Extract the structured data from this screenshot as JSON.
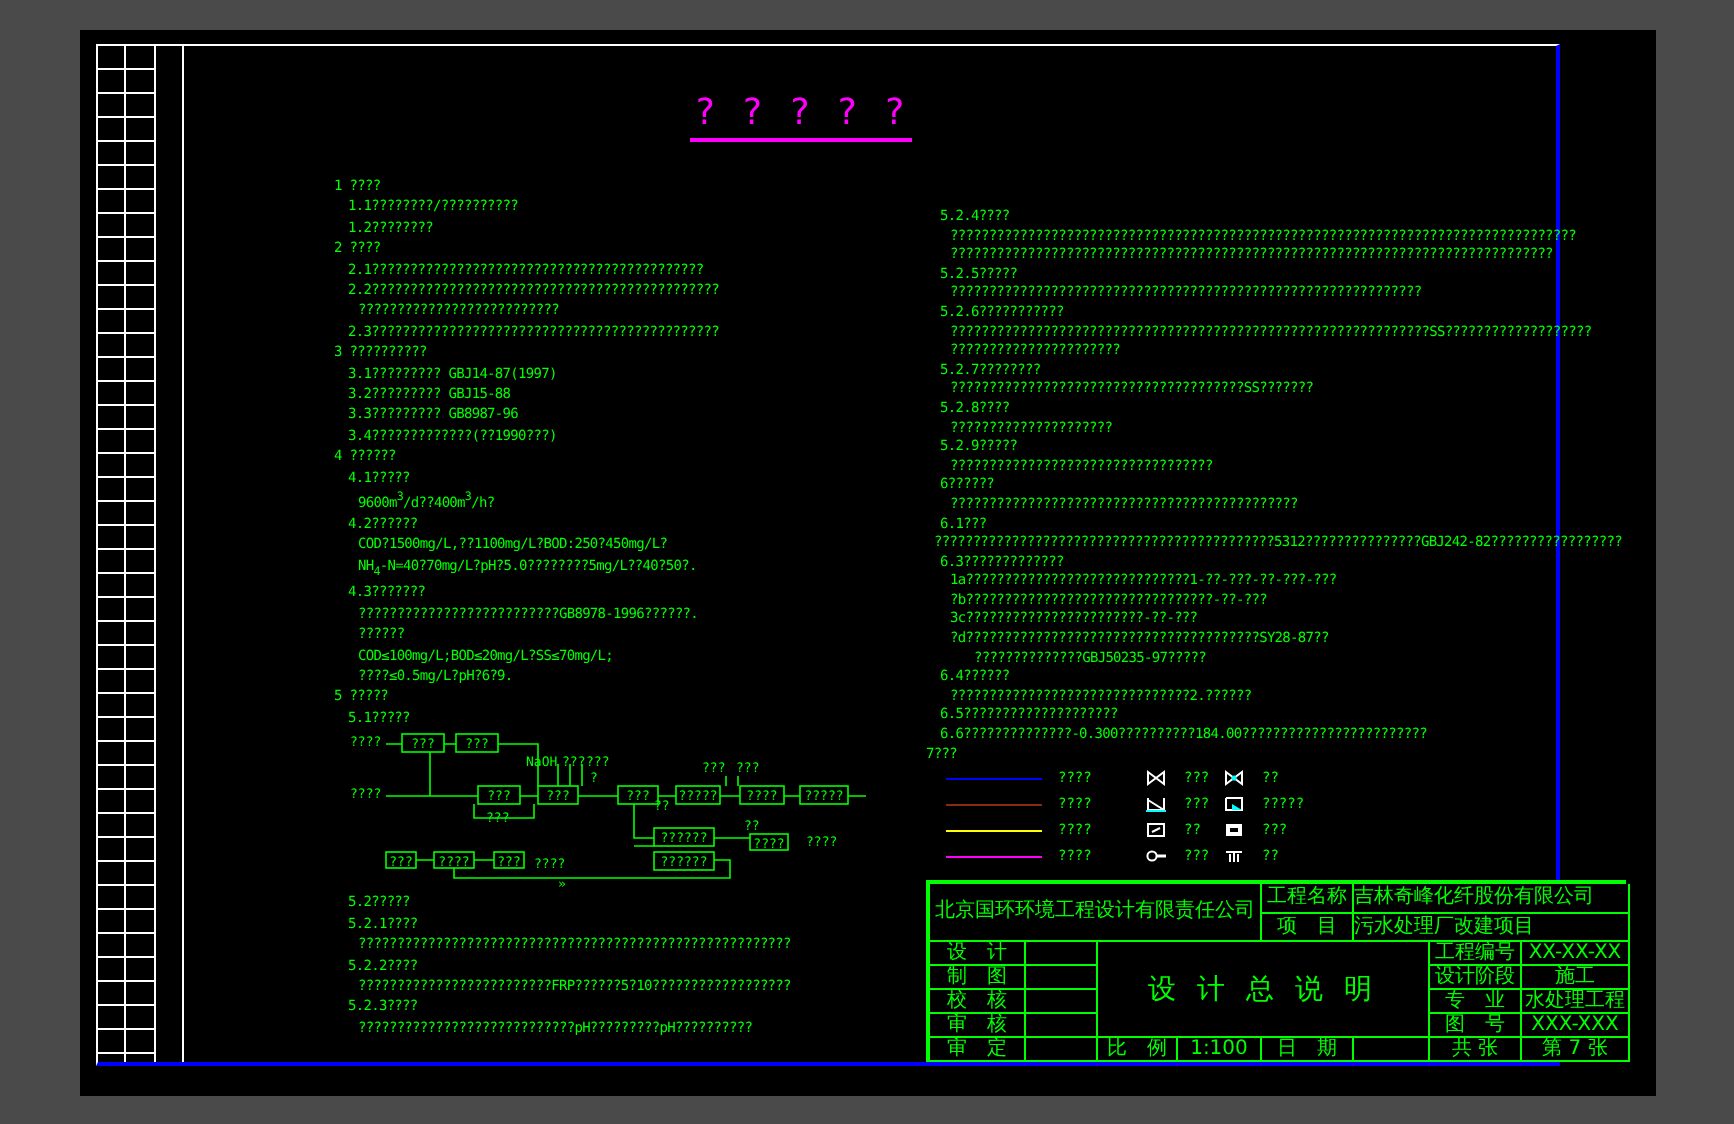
{
  "title": "? ? ? ? ?",
  "left_column": [
    {
      "kind": "h1",
      "text": "1 ????"
    },
    {
      "kind": "h2",
      "text": "1.1????????/??????????"
    },
    {
      "kind": "h2",
      "text": "1.2????????"
    },
    {
      "kind": "h1",
      "text": "2 ????"
    },
    {
      "kind": "h2",
      "text": "2.1???????????????????????????????????????????"
    },
    {
      "kind": "h2",
      "text": "2.2?????????????????????????????????????????????"
    },
    {
      "kind": "body",
      "text": "??????????????????????????"
    },
    {
      "kind": "h2",
      "text": "2.3?????????????????????????????????????????????"
    },
    {
      "kind": "h1",
      "text": "3 ??????????"
    },
    {
      "kind": "h2",
      "text": "3.1????????? GBJ14-87(1997)"
    },
    {
      "kind": "h2",
      "text": "3.2????????? GBJ15-88"
    },
    {
      "kind": "h2",
      "text": "3.3????????? GB8987-96"
    },
    {
      "kind": "h2",
      "text": "3.4?????????????(??1990???)"
    },
    {
      "kind": "h1",
      "text": "4 ??????"
    },
    {
      "kind": "h2",
      "text": "4.1?????"
    },
    {
      "kind": "body",
      "text": "9600m$^{3}$/d??400m$^{3}$/h?"
    },
    {
      "kind": "h2",
      "text": "4.2??????"
    },
    {
      "kind": "body",
      "text": "COD?1500mg/L,??1100mg/L?BOD:250?450mg/L?"
    },
    {
      "kind": "body",
      "text": "NH$_{4}$-N=40?70mg/L?pH?5.0????????5mg/L??40?50?."
    },
    {
      "kind": "h2",
      "text": "4.3???????"
    },
    {
      "kind": "body",
      "text": "??????????????????????????GB8978-1996??????."
    },
    {
      "kind": "body",
      "text": "??????"
    },
    {
      "kind": "body",
      "text": "COD≤100mg/L;BOD≤20mg/L?SS≤70mg/L;"
    },
    {
      "kind": "body",
      "text": "????≤0.5mg/L?pH?6?9."
    },
    {
      "kind": "h1",
      "text": "5 ?????"
    },
    {
      "kind": "h2",
      "text": "5.1?????"
    },
    {
      "kind": "diagram"
    },
    {
      "kind": "h2",
      "text": "5.2?????"
    },
    {
      "kind": "h2",
      "text": "5.2.1????"
    },
    {
      "kind": "body",
      "text": "????????????????????????????????????????????????????????"
    },
    {
      "kind": "h2",
      "text": "5.2.2????"
    },
    {
      "kind": "body",
      "text": "?????????????????????????FRP??????5?10??????????????????"
    },
    {
      "kind": "h2",
      "text": "5.2.3????"
    },
    {
      "kind": "body",
      "text": "????????????????????????????pH?????????pH??????????"
    }
  ],
  "flow_diagram": {
    "nodes": [
      {
        "kind": "label",
        "text": "????"
      },
      {
        "kind": "box",
        "text": "???"
      },
      {
        "kind": "box",
        "text": "???"
      },
      {
        "kind": "label",
        "text": "????"
      },
      {
        "kind": "box",
        "text": "???"
      },
      {
        "kind": "label",
        "text": "???"
      },
      {
        "kind": "label",
        "text": "NaOH"
      },
      {
        "kind": "label",
        "text": "???"
      },
      {
        "kind": "label",
        "text": "???"
      },
      {
        "kind": "box",
        "text": "???"
      },
      {
        "kind": "label",
        "text": "?"
      },
      {
        "kind": "box",
        "text": "???"
      },
      {
        "kind": "box",
        "text": "?????"
      },
      {
        "kind": "label",
        "text": "???"
      },
      {
        "kind": "label",
        "text": "???"
      },
      {
        "kind": "box",
        "text": "????"
      },
      {
        "kind": "box",
        "text": "?????"
      },
      {
        "kind": "label",
        "text": "??"
      },
      {
        "kind": "box",
        "text": "??????"
      },
      {
        "kind": "label",
        "text": "??"
      },
      {
        "kind": "box",
        "text": "????"
      },
      {
        "kind": "label",
        "text": "????"
      },
      {
        "kind": "box",
        "text": "???"
      },
      {
        "kind": "box",
        "text": "????"
      },
      {
        "kind": "box",
        "text": "???"
      },
      {
        "kind": "label",
        "text": "????"
      },
      {
        "kind": "box",
        "text": "??????"
      },
      {
        "kind": "label",
        "text": "»"
      }
    ]
  },
  "right_column": [
    {
      "kind": "h2",
      "text": "5.2.4????"
    },
    {
      "kind": "body",
      "text": "?????????????????????????????????????????????????????????????????????????????????"
    },
    {
      "kind": "body",
      "text": "??????????????????????????????????????????????????????????????????????????????"
    },
    {
      "kind": "h2",
      "text": "5.2.5?????"
    },
    {
      "kind": "body",
      "text": "?????????????????????????????????????????????????????????????"
    },
    {
      "kind": "h2",
      "text": "5.2.6???????????"
    },
    {
      "kind": "body",
      "text": "??????????????????????????????????????????????????????????????SS???????????????????"
    },
    {
      "kind": "body",
      "text": "??????????????????????"
    },
    {
      "kind": "h2",
      "text": "5.2.7????????"
    },
    {
      "kind": "body",
      "text": "??????????????????????????????????????SS???????"
    },
    {
      "kind": "h2",
      "text": "5.2.8????"
    },
    {
      "kind": "body",
      "text": "?????????????????????"
    },
    {
      "kind": "h2",
      "text": "5.2.9?????"
    },
    {
      "kind": "body",
      "text": "??????????????????????????????????"
    },
    {
      "kind": "h2",
      "text": "6??????"
    },
    {
      "kind": "body",
      "text": "?????????????????????????????????????????????"
    },
    {
      "kind": "h2",
      "text": "6.1???"
    },
    {
      "kind": "wide",
      "text": "????????????????????????????????????????????5312???????????????GBJ242-82?????????????????"
    },
    {
      "kind": "h2",
      "text": "6.3?????????????"
    },
    {
      "kind": "body",
      "text": "1a?????????????????????????????1-??-???-??-???-???"
    },
    {
      "kind": "body",
      "text": "?b????????????????????????????????-??-???"
    },
    {
      "kind": "body",
      "text": "3c???????????????????????-??-???"
    },
    {
      "kind": "body",
      "text": "?d??????????????????????????????????????SY28-87??"
    },
    {
      "kind": "body2",
      "text": "??????????????GBJ50235-97?????"
    },
    {
      "kind": "h2",
      "text": "6.4??????"
    },
    {
      "kind": "body",
      "text": "???????????????????????????????2.??????"
    },
    {
      "kind": "h2",
      "text": "6.5????????????????????"
    },
    {
      "kind": "h2",
      "text": "6.6??????????????-0.300??????????184.00????????????????????????"
    },
    {
      "kind": "h1",
      "text": "7???"
    }
  ],
  "legend": [
    {
      "color": "#0000ff",
      "label": "????",
      "icon_label": "???",
      "icon2_label": "??"
    },
    {
      "color": "#8b2a14",
      "label": "????",
      "icon_label": "???",
      "icon2_label": "?????"
    },
    {
      "color": "#ffff00",
      "label": "????",
      "icon_label": "??",
      "icon2_label": "???"
    },
    {
      "color": "#ff00ff",
      "label": "????",
      "icon_label": "???",
      "icon2_label": "??"
    }
  ],
  "title_block": {
    "company": "北京国环环境工程设计有限责任公司",
    "project_label": "工程名称",
    "project": "吉林奇峰化纤股份有限公司",
    "item_label": "项　目",
    "item": "污水处理厂改建项目",
    "sign_labels": [
      "设　计",
      "制　图",
      "校　核",
      "审　核",
      "审　定"
    ],
    "drawing_title": "设 计 总 说 明",
    "scale_label": "比　例",
    "scale": "1:100",
    "date_label": "日　期",
    "info": [
      {
        "label": "工程编号",
        "value": "XX-XX-XX"
      },
      {
        "label": "设计阶段",
        "value": "施工"
      },
      {
        "label": "专　业",
        "value": "水处理工程"
      },
      {
        "label": "图　号",
        "value": "XXX-XXX"
      },
      {
        "label": "共 张",
        "value": "第 7 张"
      }
    ]
  }
}
